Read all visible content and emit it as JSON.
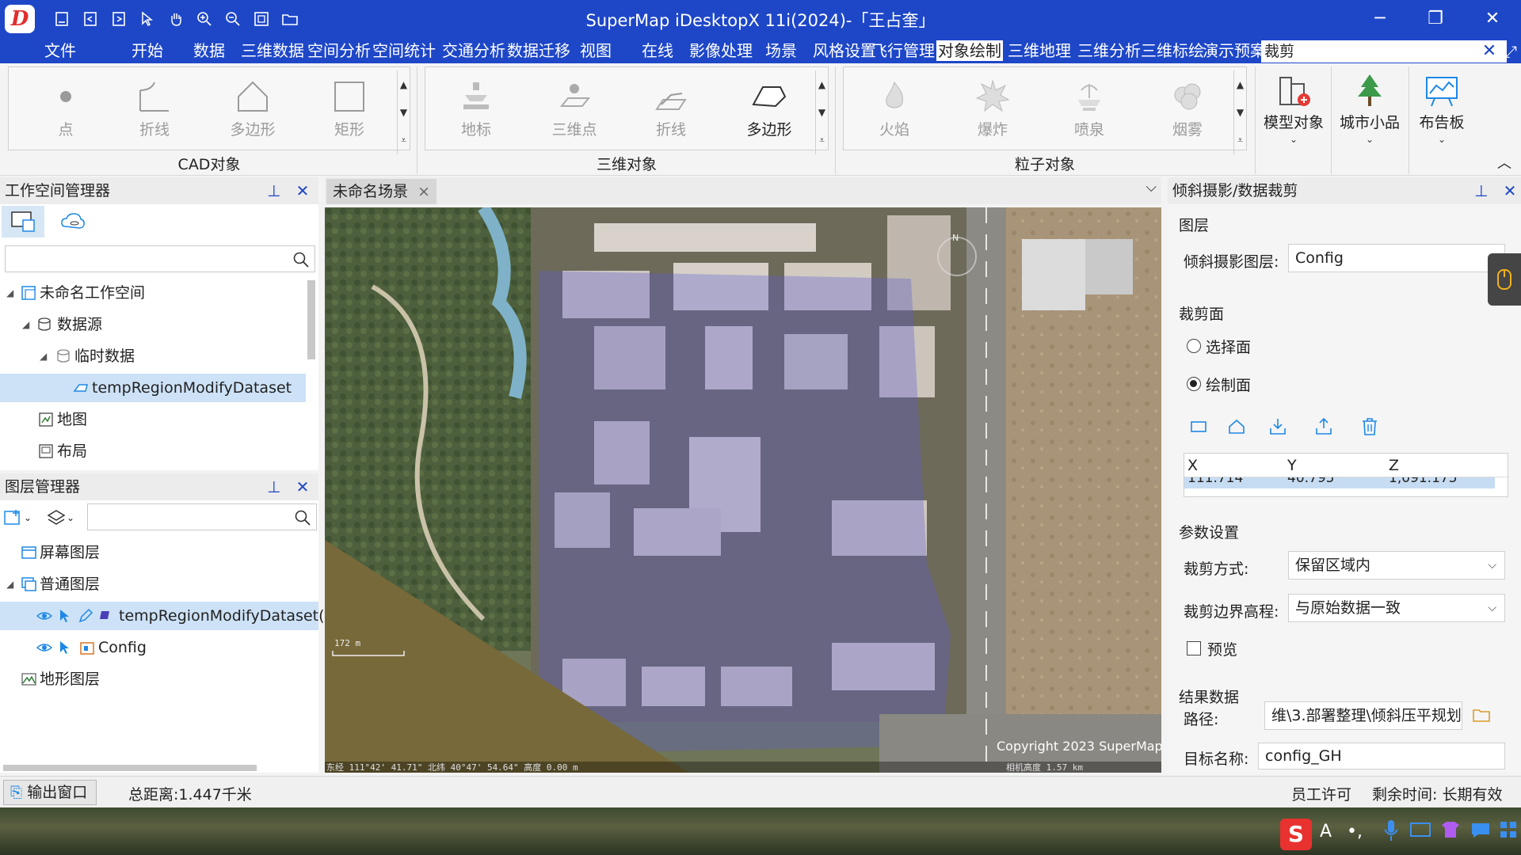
{
  "window": {
    "title": "SuperMap iDesktopX 11i(2024)-「王占奎」",
    "logo_text": "D",
    "minimize": "─",
    "restore": "❐",
    "close": "✕"
  },
  "menu": {
    "items": [
      "文件",
      "开始",
      "数据",
      "三维数据",
      "空间分析",
      "空间统计",
      "交通分析",
      "数据迁移",
      "视图",
      "在线",
      "影像处理",
      "场景",
      "风格设置",
      "飞行管理",
      "对象绘制",
      "三维地理",
      "三维分析",
      "三维标绘",
      "演示预案"
    ],
    "active": "对象绘制",
    "search_value": "裁剪",
    "search_close": "✕",
    "fullscreen": "⤢"
  },
  "ribbon": {
    "groups": [
      {
        "label": "CAD对象",
        "buttons": [
          "点",
          "折线",
          "多边形",
          "矩形"
        ]
      },
      {
        "label": "三维对象",
        "buttons": [
          "地标",
          "三维点",
          "折线",
          "多边形"
        ]
      },
      {
        "label": "粒子对象",
        "buttons": [
          "火焰",
          "爆炸",
          "喷泉",
          "烟雾"
        ]
      }
    ],
    "big_buttons": [
      "模型对象",
      "城市小品",
      "布告板"
    ],
    "collapse": "︿"
  },
  "workspace_panel": {
    "title": "工作空间管理器",
    "search_placeholder": "",
    "tree": [
      {
        "label": "未命名工作空间"
      },
      {
        "label": "数据源"
      },
      {
        "label": "临时数据"
      },
      {
        "label": "tempRegionModifyDataset"
      },
      {
        "label": "地图"
      },
      {
        "label": "布局"
      }
    ]
  },
  "layer_panel": {
    "title": "图层管理器",
    "search_placeholder": "",
    "tree": [
      {
        "label": "屏幕图层"
      },
      {
        "label": "普通图层"
      },
      {
        "label": "tempRegionModifyDataset("
      },
      {
        "label": "Config"
      },
      {
        "label": "地形图层"
      }
    ]
  },
  "scene": {
    "tab_label": "未命名场景",
    "tab_close": "×",
    "tab_dropdown": "⌵",
    "copyright": "Copyright 2023 SuperMap",
    "scale_label": "172 m",
    "coord_text": "东经 111°42' 41.71\"   北纬 40°47' 54.64\"   高度 0.00 m",
    "altitude_text": "相机高度 1.57 km",
    "compass": "N"
  },
  "clip_panel": {
    "title": "倾斜摄影/数据裁剪",
    "layer_section": "图层",
    "layer_label": "倾斜摄影图层:",
    "layer_value": "Config",
    "face_section": "裁剪面",
    "radio_select": "选择面",
    "radio_draw": "绘制面",
    "selected_radio": "绘制面",
    "table_headers": [
      "X",
      "Y",
      "Z"
    ],
    "table_partial_row": [
      "111.714",
      "40.795",
      "1,091.175"
    ],
    "params_section": "参数设置",
    "clip_mode_label": "裁剪方式:",
    "clip_mode_value": "保留区域内",
    "boundary_label": "裁剪边界高程:",
    "boundary_value": "与原始数据一致",
    "preview_label": "预览",
    "preview_checked": false,
    "result_section": "结果数据",
    "path_label": "路径:",
    "path_value": "维\\3.部署整理\\倾斜压平规划",
    "target_label": "目标名称:",
    "target_value": "config_GH"
  },
  "statusbar": {
    "output_button": "输出窗口",
    "distance": "总距离:1.447千米",
    "license": "员工许可",
    "remaining": "剩余时间: 长期有效"
  },
  "colors": {
    "accent": "#1e47c8",
    "selection": "#cde2f7",
    "clip_overlay": "#5a5ad2"
  }
}
